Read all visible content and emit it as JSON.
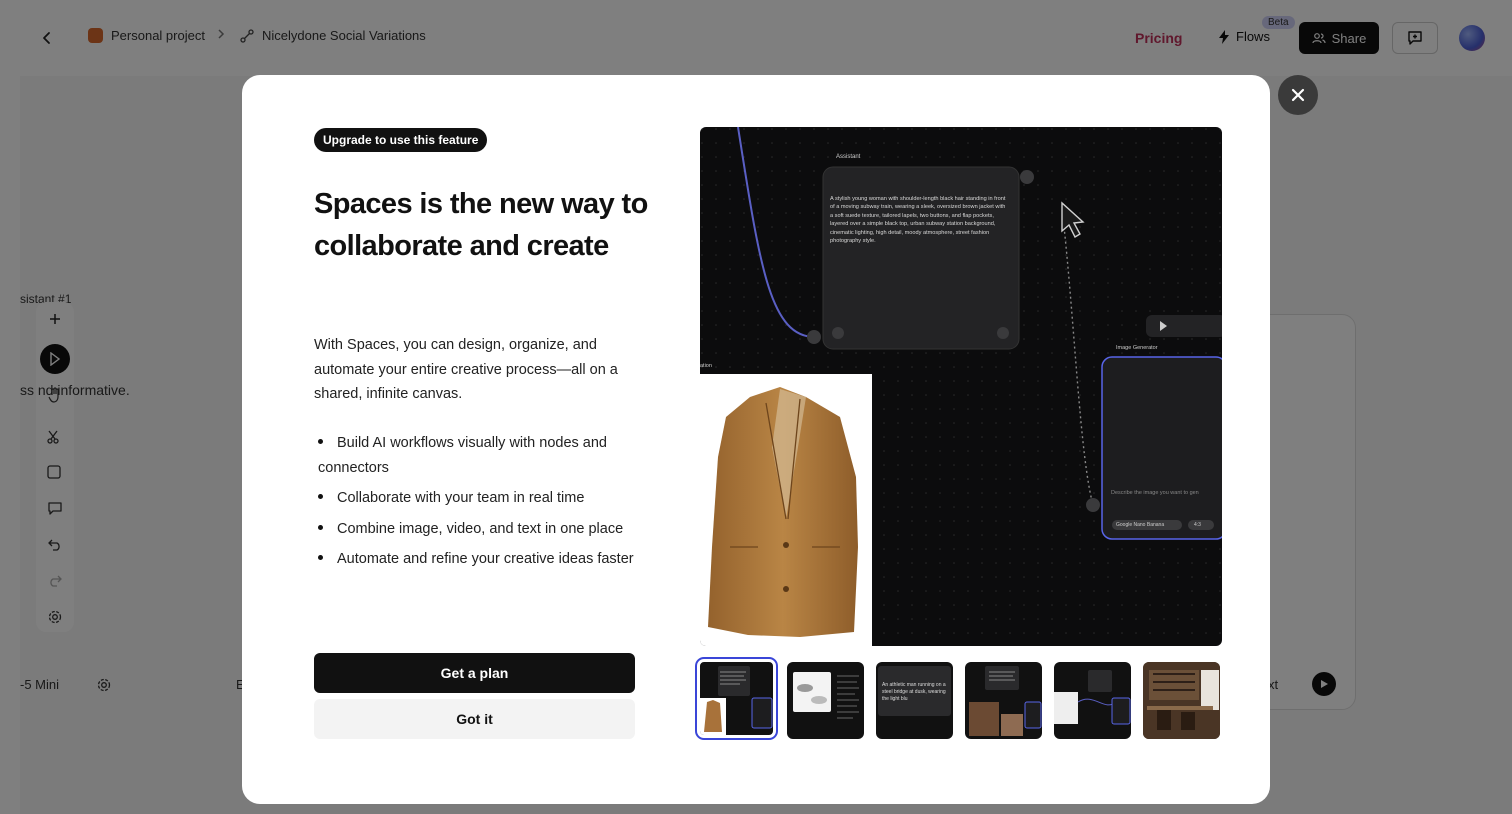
{
  "header": {
    "breadcrumb": {
      "project": "Personal project",
      "flow": "Nicelydone Social Variations"
    },
    "pricing_label": "Pricing",
    "flows_label": "Flows",
    "beta_label": "Beta",
    "share_label": "Share"
  },
  "background": {
    "node_label": "sistant #1",
    "node_text": "ss     nd informative.",
    "model_label": "-5 Mini",
    "right_text": "xt",
    "b_label": "E"
  },
  "modal": {
    "badge": "Upgrade to use this feature",
    "title": "Spaces is the new way to collaborate and create",
    "description": "With Spaces, you can design, organize, and automate your entire creative process—all on a shared, infinite canvas.",
    "features": [
      "Build AI workflows visually with nodes and connectors",
      "Collaborate with your team in real time",
      "Combine image, video, and text in one place",
      "Automate and refine your creative ideas faster"
    ],
    "primary_button": "Get a plan",
    "secondary_button": "Got it",
    "active_thumbnail": 1,
    "thumbnail_count": 6
  },
  "preview": {
    "assistant_label": "Assistant",
    "prompt_text": "A stylish young woman with shoulder-length black hair standing in front of a moving subway train, wearing a sleek, oversized brown jacket with a soft suede texture, tailored lapels, two buttons, and flap pockets, layered over a simple black top, urban subway station background, cinematic lighting, high detail, moody atmosphere, street fashion photography style.",
    "image_generator_label": "Image Generator",
    "image_prompt_placeholder": "Describe the image you want to gen",
    "model_chip": "Google Nano Banana",
    "ratio_chip": "4:3",
    "left_node_label": "ation",
    "thumb3_text": "An athletic man running on a steel bridge at dusk, wearing the light blu"
  },
  "colors": {
    "accent": "#3a46d8",
    "pricing": "#c0305a",
    "dark": "#111111",
    "coat": "#b07a3e"
  }
}
